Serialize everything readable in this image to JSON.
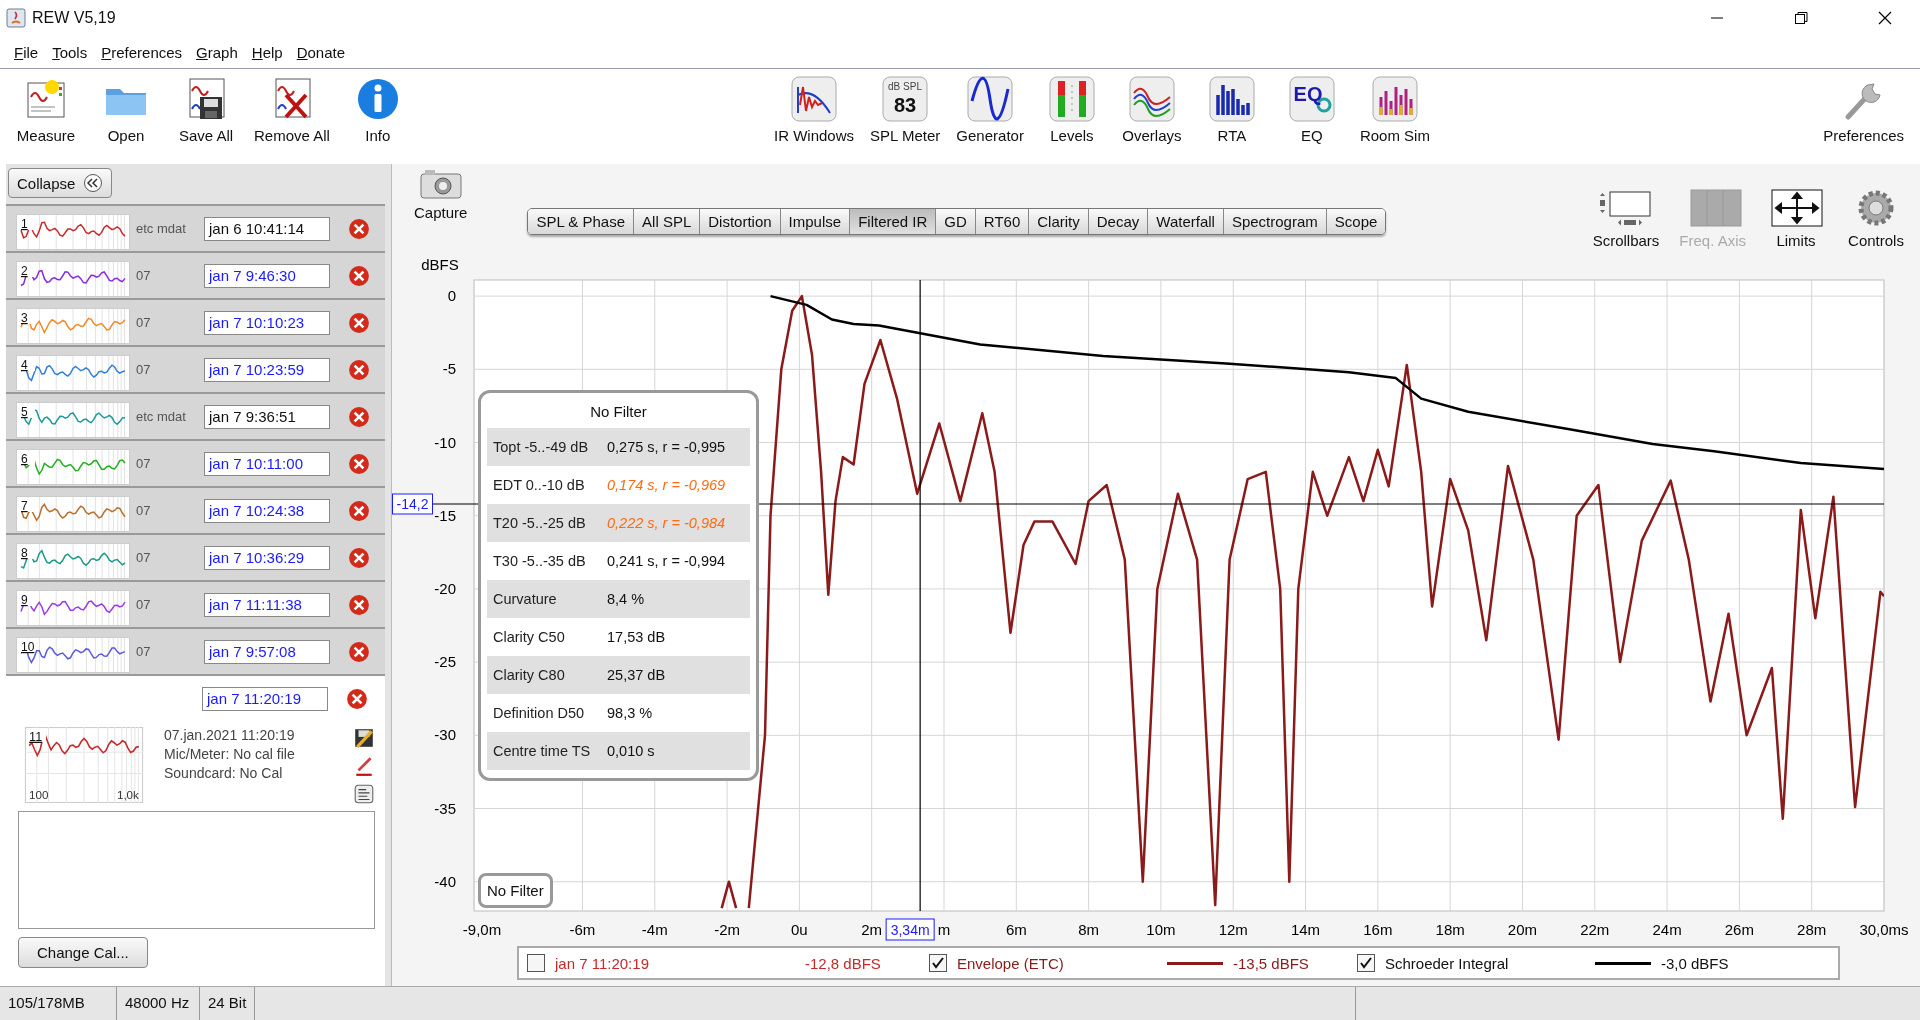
{
  "window": {
    "title": "REW V5,19"
  },
  "menu": [
    {
      "label": "File"
    },
    {
      "label": "Tools"
    },
    {
      "label": "Preferences"
    },
    {
      "label": "Graph"
    },
    {
      "label": "Help"
    },
    {
      "label": "Donate"
    }
  ],
  "toolbar": {
    "left": [
      {
        "label": "Measure",
        "kind": "measure"
      },
      {
        "label": "Open",
        "kind": "open"
      },
      {
        "label": "Save All",
        "kind": "saveall"
      },
      {
        "label": "Remove All",
        "kind": "removeall"
      },
      {
        "label": "Info",
        "kind": "info"
      }
    ],
    "center": [
      {
        "label": "IR Windows",
        "kind": "irwindows"
      },
      {
        "label": "SPL Meter",
        "kind": "splmeter",
        "icon_texts": [
          "dB SPL",
          "83"
        ]
      },
      {
        "label": "Generator",
        "kind": "generator"
      },
      {
        "label": "Levels",
        "kind": "levels"
      },
      {
        "label": "Overlays",
        "kind": "overlays"
      },
      {
        "label": "RTA",
        "kind": "rta"
      },
      {
        "label": "EQ",
        "kind": "eq",
        "icon_texts": [
          "EQ"
        ]
      },
      {
        "label": "Room Sim",
        "kind": "roomsim"
      }
    ],
    "right": [
      {
        "label": "Preferences",
        "kind": "wrench"
      }
    ]
  },
  "measurements": {
    "collapse_label": "Collapse",
    "items": [
      {
        "number": "1",
        "name": "jan 6 10:41:14",
        "name_highlighted": false,
        "color": "#c62a2a",
        "peek": "etc mdat",
        "selected": false
      },
      {
        "number": "2",
        "name": "jan 7 9:46:30",
        "name_highlighted": true,
        "color": "#8a2be2",
        "peek": "07",
        "selected": false
      },
      {
        "number": "3",
        "name": "jan 7 10:10:23",
        "name_highlighted": true,
        "color": "#f08a24",
        "peek": "07",
        "selected": false
      },
      {
        "number": "4",
        "name": "jan 7 10:23:59",
        "name_highlighted": true,
        "color": "#2f7fd8",
        "peek": "07",
        "selected": false
      },
      {
        "number": "5",
        "name": "jan 7 9:36:51",
        "name_highlighted": false,
        "color": "#1a9a9a",
        "peek": "etc mdat",
        "selected": false
      },
      {
        "number": "6",
        "name": "jan 7 10:11:00",
        "name_highlighted": true,
        "color": "#22b022",
        "peek": "07",
        "selected": false
      },
      {
        "number": "7",
        "name": "jan 7 10:24:38",
        "name_highlighted": true,
        "color": "#b8702a",
        "peek": "07",
        "selected": false
      },
      {
        "number": "8",
        "name": "jan 7 10:36:29",
        "name_highlighted": true,
        "color": "#1a9a8a",
        "peek": "07",
        "selected": false
      },
      {
        "number": "9",
        "name": "jan 7 11:11:38",
        "name_highlighted": true,
        "color": "#9a3ae8",
        "peek": "07",
        "selected": false
      },
      {
        "number": "10",
        "name": "jan 7 9:57:08",
        "name_highlighted": true,
        "color": "#5a5ae0",
        "peek": "07",
        "selected": false
      },
      {
        "number": "11",
        "name": "jan 7 11:20:19",
        "name_highlighted": true,
        "color": "#c62a2a",
        "selected": true,
        "details": {
          "date": "07.jan.2021 11:20:19",
          "mic": "Mic/Meter: No cal file",
          "soundcard": "Soundcard: No Cal",
          "axis_labels": [
            "100",
            "1,0k"
          ]
        }
      }
    ],
    "change_cal_label": "Change Cal..."
  },
  "graph": {
    "capture_label": "Capture",
    "tabs": [
      {
        "label": "SPL & Phase",
        "selected": false
      },
      {
        "label": "All SPL",
        "selected": false
      },
      {
        "label": "Distortion",
        "selected": false
      },
      {
        "label": "Impulse",
        "selected": false
      },
      {
        "label": "Filtered IR",
        "selected": true
      },
      {
        "label": "GD",
        "selected": false
      },
      {
        "label": "RT60",
        "selected": false
      },
      {
        "label": "Clarity",
        "selected": false
      },
      {
        "label": "Decay",
        "selected": false
      },
      {
        "label": "Waterfall",
        "selected": false
      },
      {
        "label": "Spectrogram",
        "selected": false
      },
      {
        "label": "Scope",
        "selected": false
      }
    ],
    "tools": [
      {
        "label": "Scrollbars",
        "kind": "scrollbars",
        "disabled": false
      },
      {
        "label": "Freq. Axis",
        "kind": "freqaxis",
        "disabled": true
      },
      {
        "label": "Limits",
        "kind": "limits",
        "disabled": false
      },
      {
        "label": "Controls",
        "kind": "controls",
        "disabled": false
      }
    ],
    "filter_button": "No Filter",
    "stats": {
      "title": "No Filter",
      "rows": [
        {
          "label": "Topt -5..-49 dB",
          "value": "0,275 s,  r = -0,995",
          "warning": false
        },
        {
          "label": "EDT  0..-10 dB",
          "value": "0,174 s, r = -0,969",
          "warning": true
        },
        {
          "label": "T20 -5..-25 dB",
          "value": "0,222 s, r = -0,984",
          "warning": true
        },
        {
          "label": "T30 -5..-35 dB",
          "value": "0,241 s,  r = -0,994",
          "warning": false
        },
        {
          "label": "Curvature",
          "value": "8,4 %",
          "warning": false
        },
        {
          "label": "Clarity C50",
          "value": "17,53 dB",
          "warning": false
        },
        {
          "label": "Clarity C80",
          "value": "25,37 dB",
          "warning": false
        },
        {
          "label": "Definition D50",
          "value": "98,3 %",
          "warning": false
        },
        {
          "label": "Centre time TS",
          "value": "0,010 s",
          "warning": false
        }
      ]
    },
    "chart_data": {
      "type": "line",
      "ylabel": "dBFS",
      "xlim": [
        -9,
        30
      ],
      "ylim": [
        -42,
        1.1
      ],
      "xticks": [
        {
          "value": -9,
          "label": "-9,0m"
        },
        {
          "value": -6,
          "label": "-6m"
        },
        {
          "value": -4,
          "label": "-4m"
        },
        {
          "value": -2,
          "label": "-2m"
        },
        {
          "value": 0,
          "label": "0u"
        },
        {
          "value": 2,
          "label": "2m"
        },
        {
          "value": 4,
          "label": "m"
        },
        {
          "value": 6,
          "label": "6m"
        },
        {
          "value": 8,
          "label": "8m"
        },
        {
          "value": 10,
          "label": "10m"
        },
        {
          "value": 12,
          "label": "12m"
        },
        {
          "value": 14,
          "label": "14m"
        },
        {
          "value": 16,
          "label": "16m"
        },
        {
          "value": 18,
          "label": "18m"
        },
        {
          "value": 20,
          "label": "20m"
        },
        {
          "value": 22,
          "label": "22m"
        },
        {
          "value": 24,
          "label": "24m"
        },
        {
          "value": 26,
          "label": "26m"
        },
        {
          "value": 28,
          "label": "28m"
        },
        {
          "value": 30,
          "label": "30,0ms"
        }
      ],
      "yticks": [
        0,
        -5,
        -10,
        -15,
        -20,
        -25,
        -30,
        -35,
        -40
      ],
      "series": [
        {
          "name": "Envelope (ETC)",
          "color": "#8b1a1a",
          "x": [
            -2.15,
            -1.95,
            -1.75,
            -1.6,
            -1.4,
            -0.95,
            -0.8,
            -0.5,
            -0.2,
            0.07,
            0.35,
            0.6,
            0.8,
            1.0,
            1.2,
            1.5,
            1.8,
            2.24,
            2.7,
            3.26,
            3.87,
            4.45,
            5.06,
            5.4,
            5.84,
            6.2,
            6.5,
            7.0,
            7.64,
            8.0,
            8.5,
            9.0,
            9.5,
            9.9,
            10.47,
            11.0,
            11.5,
            11.9,
            12.4,
            12.9,
            13.3,
            13.55,
            13.8,
            14.2,
            14.6,
            15.2,
            15.6,
            16.0,
            16.3,
            16.8,
            17.2,
            17.5,
            18.0,
            18.5,
            19.0,
            19.6,
            20.3,
            21.0,
            21.5,
            22.1,
            22.7,
            23.3,
            24.1,
            24.6,
            25.2,
            25.7,
            26.2,
            26.9,
            27.2,
            27.7,
            28.1,
            28.6,
            29.2,
            29.9,
            30
          ],
          "values": [
            -41.8,
            -40,
            -41.8,
            null,
            -41.8,
            -30,
            -15,
            -5,
            -1,
            0,
            -4,
            -12,
            -20.4,
            -14,
            -11,
            -11.5,
            -6,
            -3,
            -7,
            -13.5,
            -8.7,
            -14,
            -8,
            -12,
            -23,
            -17,
            -15.4,
            -15.4,
            -18.3,
            -14,
            -12.9,
            -18,
            -40,
            -20,
            -13.5,
            -18,
            -41.6,
            -18,
            -12.5,
            -12,
            -20,
            -40,
            -20,
            -12,
            -15,
            -11,
            -14,
            -10.5,
            -13,
            -4.7,
            -12,
            -21.2,
            -12.5,
            -16,
            -23.5,
            -11.6,
            -18,
            -30.3,
            -15,
            -12.9,
            -25,
            -16.7,
            -12.6,
            -18,
            -27.7,
            -21.7,
            -30,
            -25.4,
            -35.7,
            -14.6,
            -22,
            -13.7,
            -34.9,
            -20.2,
            -20.5
          ]
        },
        {
          "name": "Schroeder Integral",
          "color": "#000000",
          "x": [
            -0.8,
            0.2,
            0.9,
            1.5,
            2.2,
            5,
            8.4,
            11.8,
            15.2,
            16.5,
            17.2,
            18.5,
            21.3,
            23.6,
            25.3,
            27.7,
            30
          ],
          "values": [
            0,
            -0.6,
            -1.6,
            -1.9,
            -2,
            -3.3,
            -4.1,
            -4.6,
            -5.2,
            -5.6,
            -7,
            -7.9,
            -9.1,
            -10.1,
            -10.6,
            -11.4,
            -11.8
          ]
        }
      ],
      "grid": true,
      "ref_lines": [
        {
          "axis": "x",
          "value": 3.34,
          "label": "3,34m",
          "color": "#000000"
        },
        {
          "axis": "y",
          "value": -14.2,
          "label": "-14,2",
          "color": "#000000"
        }
      ]
    },
    "legend": [
      {
        "kind": "measurement",
        "label": "jan 7 11:20:19",
        "value": "-12,8 dBFS",
        "checked": false,
        "color": "#c62a2a"
      },
      {
        "kind": "trace",
        "value": "-13,5 dBFS",
        "checked": true
      },
      {
        "kind": "trace",
        "value": "-3,0 dBFS",
        "checked": true
      }
    ]
  },
  "status_bar": [
    {
      "text": "105/178MB"
    },
    {
      "text": "48000 Hz"
    },
    {
      "text": "24 Bit"
    }
  ]
}
